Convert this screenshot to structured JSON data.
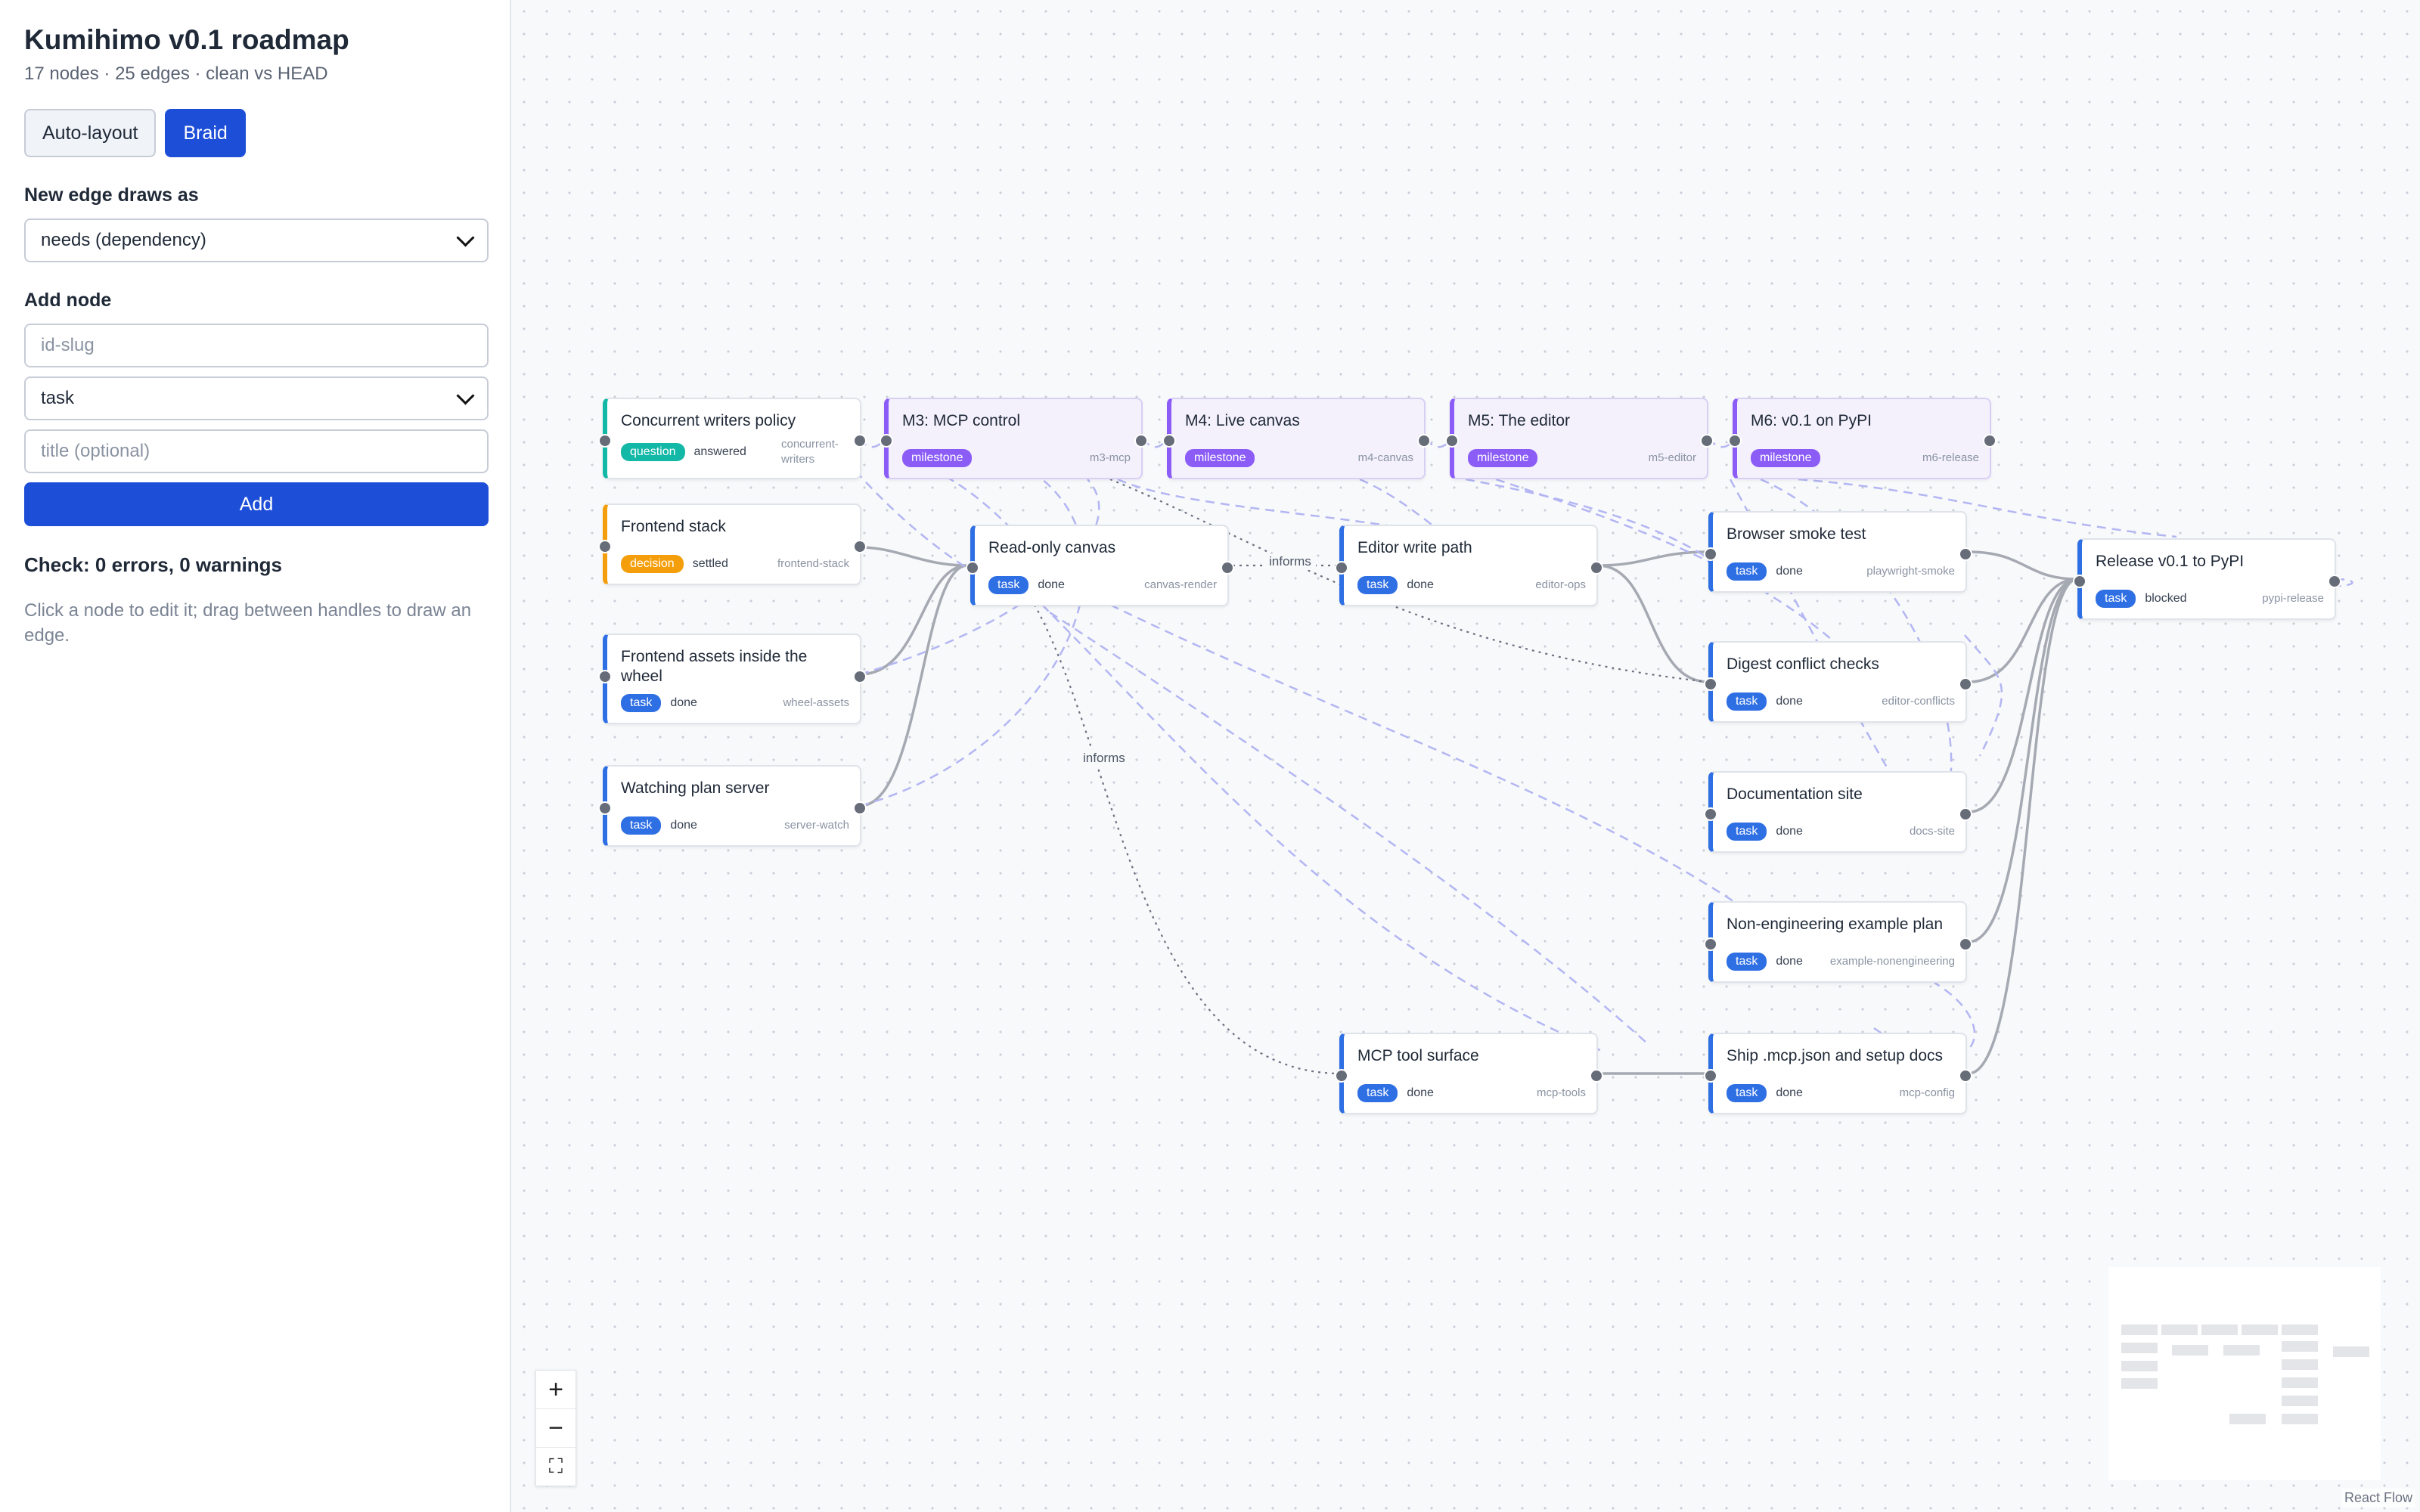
{
  "sidebar": {
    "title": "Kumihimo v0.1 roadmap",
    "subtitle": "17 nodes · 25 edges · clean vs HEAD",
    "autolayout_label": "Auto-layout",
    "braid_label": "Braid",
    "edge_mode_heading": "New edge draws as",
    "edge_mode_value": "needs (dependency)",
    "add_node_heading": "Add node",
    "id_placeholder": "id-slug",
    "kind_value": "task",
    "title_placeholder": "title (optional)",
    "add_label": "Add",
    "check_text": "Check: 0 errors, 0 warnings",
    "hint": "Click a node to edit it; drag between handles to draw an edge."
  },
  "colors": {
    "accent": "#1d4ed8",
    "task": "#2f6fe4",
    "milestone": "#8b5cf6",
    "question": "#14b8a6",
    "decision": "#f59e0b"
  },
  "nodes": {
    "writers": {
      "title": "Concurrent writers policy",
      "kind": "question",
      "status": "answered",
      "slug": "concurrent-\nwriters"
    },
    "m3": {
      "title": "M3: MCP control",
      "kind": "milestone",
      "slug": "m3-mcp"
    },
    "m4": {
      "title": "M4: Live canvas",
      "kind": "milestone",
      "slug": "m4-canvas"
    },
    "m5": {
      "title": "M5: The editor",
      "kind": "milestone",
      "slug": "m5-editor"
    },
    "m6": {
      "title": "M6: v0.1 on PyPI",
      "kind": "milestone",
      "slug": "m6-release"
    },
    "frontend": {
      "title": "Frontend stack",
      "kind": "decision",
      "status": "settled",
      "slug": "frontend-stack"
    },
    "canvas": {
      "title": "Read-only canvas",
      "kind": "task",
      "status": "done",
      "slug": "canvas-render"
    },
    "editor": {
      "title": "Editor write path",
      "kind": "task",
      "status": "done",
      "slug": "editor-ops"
    },
    "smoke": {
      "title": "Browser smoke test",
      "kind": "task",
      "status": "done",
      "slug": "playwright-smoke"
    },
    "release": {
      "title": "Release v0.1 to PyPI",
      "kind": "task",
      "status": "blocked",
      "slug": "pypi-release"
    },
    "assets": {
      "title": "Frontend assets inside the wheel",
      "kind": "task",
      "status": "done",
      "slug": "wheel-assets"
    },
    "conflict": {
      "title": "Digest conflict checks",
      "kind": "task",
      "status": "done",
      "slug": "editor-conflicts"
    },
    "watch": {
      "title": "Watching plan server",
      "kind": "task",
      "status": "done",
      "slug": "server-watch"
    },
    "docs": {
      "title": "Documentation site",
      "kind": "task",
      "status": "done",
      "slug": "docs-site"
    },
    "example": {
      "title": "Non-engineering example plan",
      "kind": "task",
      "status": "done",
      "slug": "example-nonengineering"
    },
    "tools": {
      "title": "MCP tool surface",
      "kind": "task",
      "status": "done",
      "slug": "mcp-tools"
    },
    "mcpcfg": {
      "title": "Ship .mcp.json and setup docs",
      "kind": "task",
      "status": "done",
      "slug": "mcp-config"
    }
  },
  "edge_labels": {
    "informs": "informs"
  },
  "controls": {
    "zoom_in": "+",
    "zoom_out": "−",
    "fit": "⛶"
  },
  "attribution": "React Flow"
}
